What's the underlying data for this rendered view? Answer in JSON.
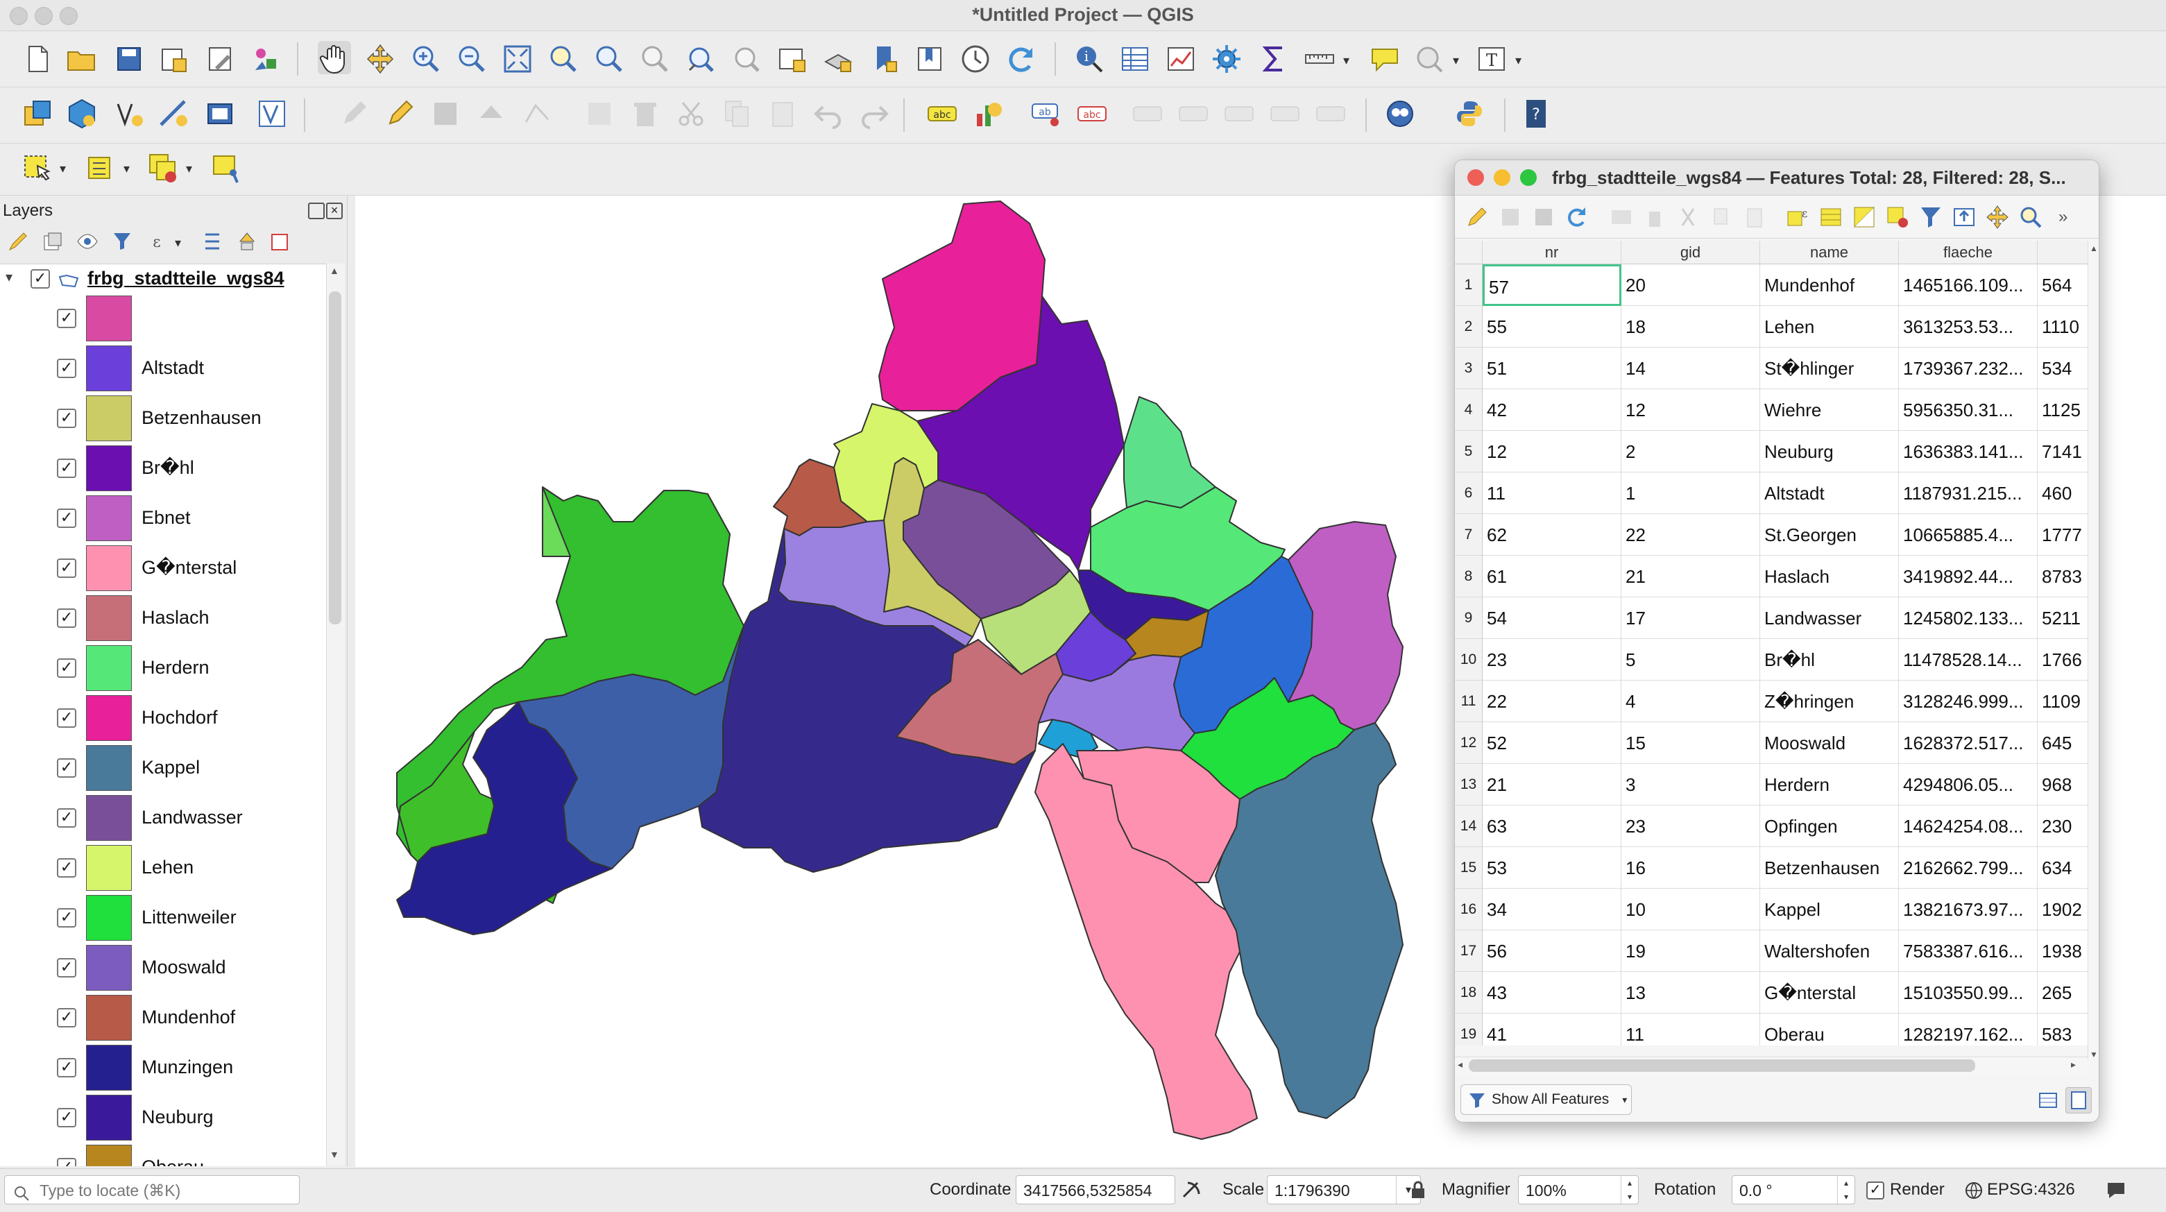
{
  "window": {
    "title": "*Untitled Project — QGIS"
  },
  "layers_panel": {
    "title": "Layers",
    "group_name": "frbg_stadtteile_wgs84",
    "items": [
      {
        "label": "",
        "color": "#d94ba3"
      },
      {
        "label": "Altstadt",
        "color": "#6b3fd9"
      },
      {
        "label": "Betzenhausen",
        "color": "#cccc66"
      },
      {
        "label": "Br�hl",
        "color": "#6b0fb0"
      },
      {
        "label": "Ebnet",
        "color": "#bf5fc4"
      },
      {
        "label": "G�nterstal",
        "color": "#ff91b0"
      },
      {
        "label": "Haslach",
        "color": "#c76f78"
      },
      {
        "label": "Herdern",
        "color": "#55e878"
      },
      {
        "label": "Hochdorf",
        "color": "#e8209a"
      },
      {
        "label": "Kappel",
        "color": "#4a7a9a"
      },
      {
        "label": "Landwasser",
        "color": "#7a4f9a"
      },
      {
        "label": "Lehen",
        "color": "#d6f56b"
      },
      {
        "label": "Littenweiler",
        "color": "#1fe03c"
      },
      {
        "label": "Mooswald",
        "color": "#7d5cbf"
      },
      {
        "label": "Mundenhof",
        "color": "#b85a48"
      },
      {
        "label": "Munzingen",
        "color": "#25208f"
      },
      {
        "label": "Neuburg",
        "color": "#3a1a9a"
      },
      {
        "label": "Oberau",
        "color": "#b8861f"
      }
    ]
  },
  "attribute_table": {
    "title": "frbg_stadtteile_wgs84 — Features Total: 28, Filtered: 28, S...",
    "columns": [
      "nr",
      "gid",
      "name",
      "flaeche",
      ""
    ],
    "rows": [
      [
        "1",
        "57",
        "20",
        "Mundenhof",
        "1465166.109...",
        "564"
      ],
      [
        "2",
        "55",
        "18",
        "Lehen",
        "3613253.53...",
        "1110"
      ],
      [
        "3",
        "51",
        "14",
        "St�hlinger",
        "1739367.232...",
        "534"
      ],
      [
        "4",
        "42",
        "12",
        "Wiehre",
        "5956350.31...",
        "1125"
      ],
      [
        "5",
        "12",
        "2",
        "Neuburg",
        "1636383.141...",
        "7141"
      ],
      [
        "6",
        "11",
        "1",
        "Altstadt",
        "1187931.215...",
        "460"
      ],
      [
        "7",
        "62",
        "22",
        "St.Georgen",
        "10665885.4...",
        "1777"
      ],
      [
        "8",
        "61",
        "21",
        "Haslach",
        "3419892.44...",
        "8783"
      ],
      [
        "9",
        "54",
        "17",
        "Landwasser",
        "1245802.133...",
        "5211"
      ],
      [
        "10",
        "23",
        "5",
        "Br�hl",
        "11478528.14...",
        "1766"
      ],
      [
        "11",
        "22",
        "4",
        "Z�hringen",
        "3128246.999...",
        "1109"
      ],
      [
        "12",
        "52",
        "15",
        "Mooswald",
        "1628372.517...",
        "645"
      ],
      [
        "13",
        "21",
        "3",
        "Herdern",
        "4294806.05...",
        "968"
      ],
      [
        "14",
        "63",
        "23",
        "Opfingen",
        "14624254.08...",
        "230"
      ],
      [
        "15",
        "53",
        "16",
        "Betzenhausen",
        "2162662.799...",
        "634"
      ],
      [
        "16",
        "34",
        "10",
        "Kappel",
        "13821673.97...",
        "1902"
      ],
      [
        "17",
        "56",
        "19",
        "Waltershofen",
        "7583387.616...",
        "1938"
      ],
      [
        "18",
        "43",
        "13",
        "G�nterstal",
        "15103550.99...",
        "265"
      ],
      [
        "19",
        "41",
        "11",
        "Oberau",
        "1282197.162...",
        "583"
      ]
    ],
    "show_all_label": "Show All Features"
  },
  "statusbar": {
    "locate_placeholder": "Type to locate (⌘K)",
    "coordinate_label": "Coordinate",
    "coordinate_value": "3417566,5325854",
    "scale_label": "Scale",
    "scale_value": "1:1796390",
    "magnifier_label": "Magnifier",
    "magnifier_value": "100%",
    "rotation_label": "Rotation",
    "rotation_value": "0.0 °",
    "render_label": "Render",
    "crs_label": "EPSG:4326"
  }
}
